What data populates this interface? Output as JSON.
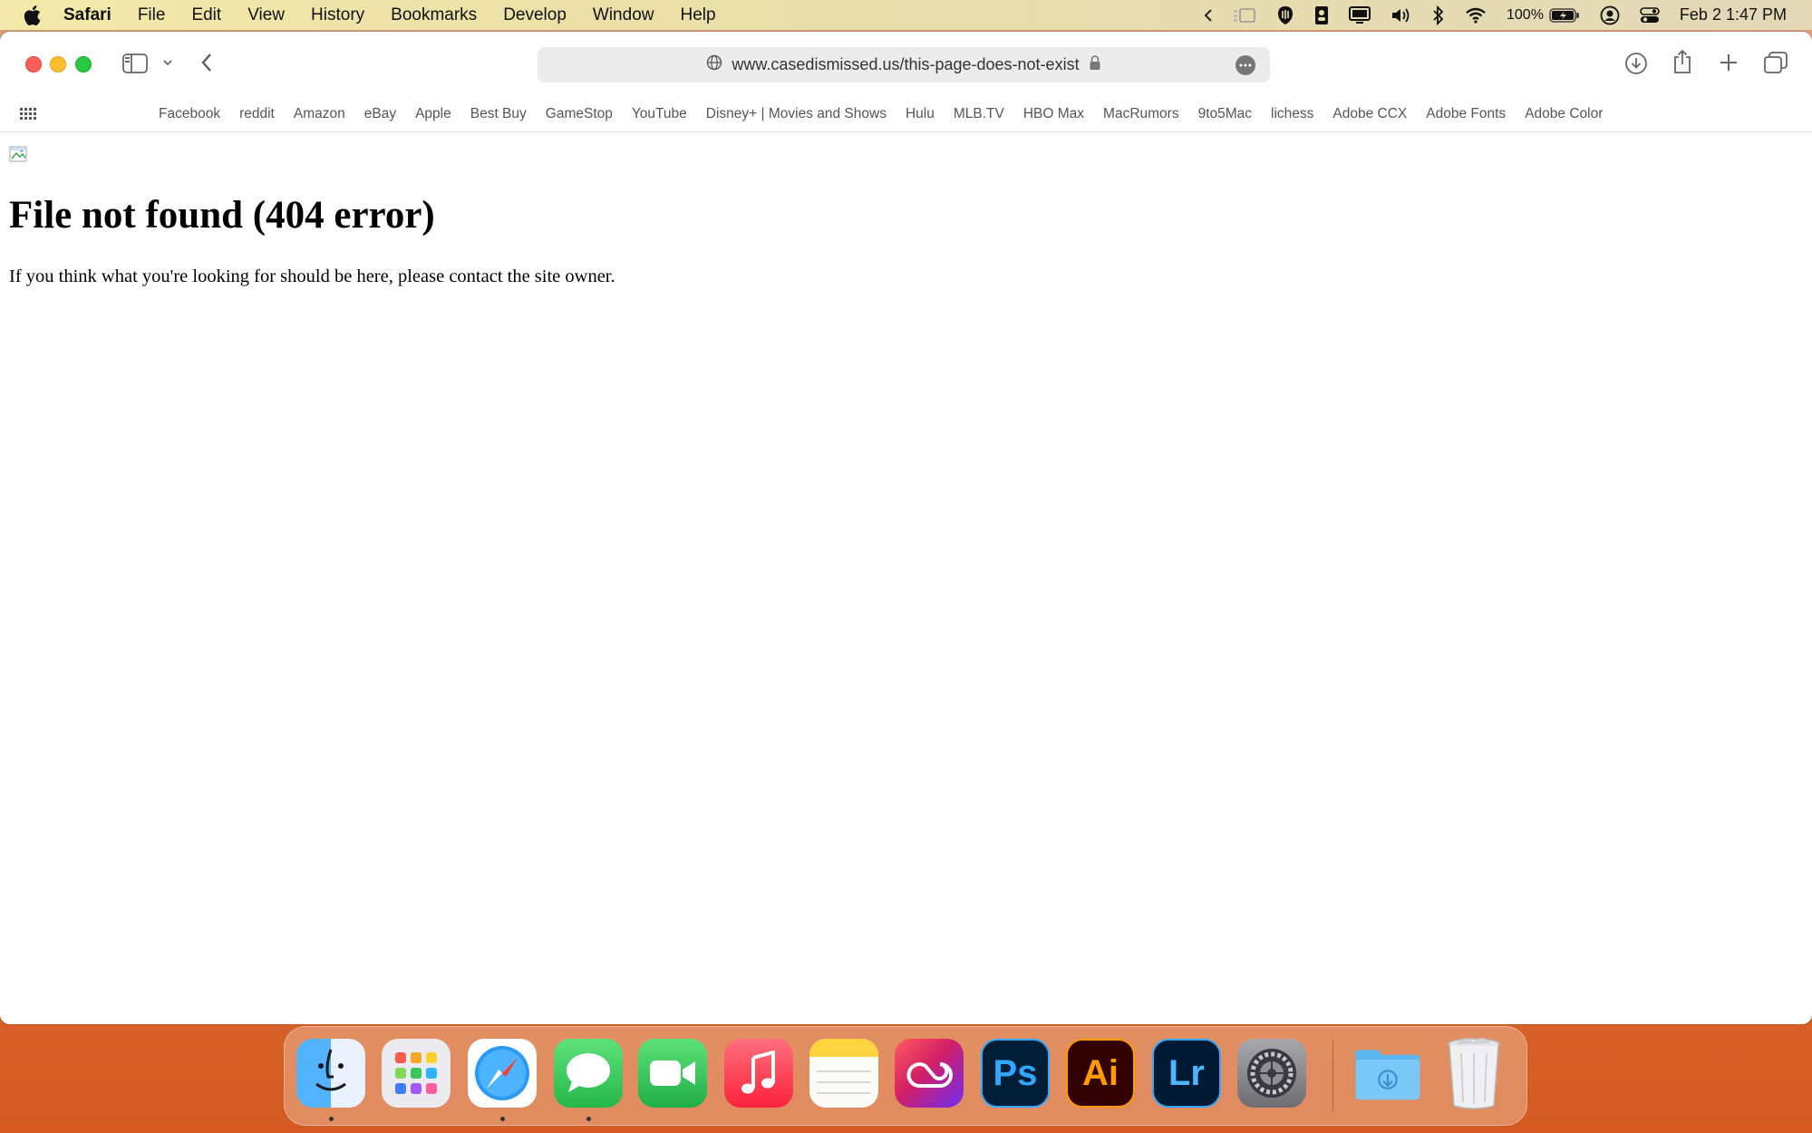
{
  "menubar": {
    "app_name": "Safari",
    "items": [
      "File",
      "Edit",
      "View",
      "History",
      "Bookmarks",
      "Develop",
      "Window",
      "Help"
    ],
    "battery": "100%",
    "clock": "Feb 2  1:47 PM"
  },
  "browser": {
    "url": "www.casedismissed.us/this-page-does-not-exist",
    "favorites": [
      "Facebook",
      "reddit",
      "Amazon",
      "eBay",
      "Apple",
      "Best Buy",
      "GameStop",
      "YouTube",
      "Disney+ | Movies and Shows",
      "Hulu",
      "MLB.TV",
      "HBO Max",
      "MacRumors",
      "9to5Mac",
      "lichess",
      "Adobe CCX",
      "Adobe Fonts",
      "Adobe Color"
    ]
  },
  "page": {
    "title": "File not found (404 error)",
    "message": "If you think what you're looking for should be here, please contact the site owner."
  },
  "dock": {
    "apps": [
      {
        "name": "finder-icon",
        "label": "",
        "color": "#1e8ef7",
        "running": true
      },
      {
        "name": "launchpad-icon",
        "label": "",
        "color": "#e8e8ec",
        "running": false
      },
      {
        "name": "safari-icon",
        "label": "",
        "color": "#2b9af3",
        "running": true
      },
      {
        "name": "messages-icon",
        "label": "",
        "color": "#34c759",
        "running": true
      },
      {
        "name": "facetime-icon",
        "label": "",
        "color": "#2fc84f",
        "running": false
      },
      {
        "name": "music-icon",
        "label": "",
        "color": "#fb3c52",
        "running": false
      },
      {
        "name": "notes-icon",
        "label": "",
        "color": "#fbfbf6",
        "running": false
      },
      {
        "name": "creative-cloud-icon",
        "label": "",
        "color": "#da1f26",
        "running": false
      },
      {
        "name": "photoshop-icon",
        "label": "Ps",
        "color": "#001e36",
        "running": false
      },
      {
        "name": "illustrator-icon",
        "label": "Ai",
        "color": "#330000",
        "running": false
      },
      {
        "name": "lightroom-icon",
        "label": "Lr",
        "color": "#001a33",
        "running": false
      },
      {
        "name": "system-settings-icon",
        "label": "",
        "color": "#8e8e93",
        "running": false
      }
    ]
  }
}
